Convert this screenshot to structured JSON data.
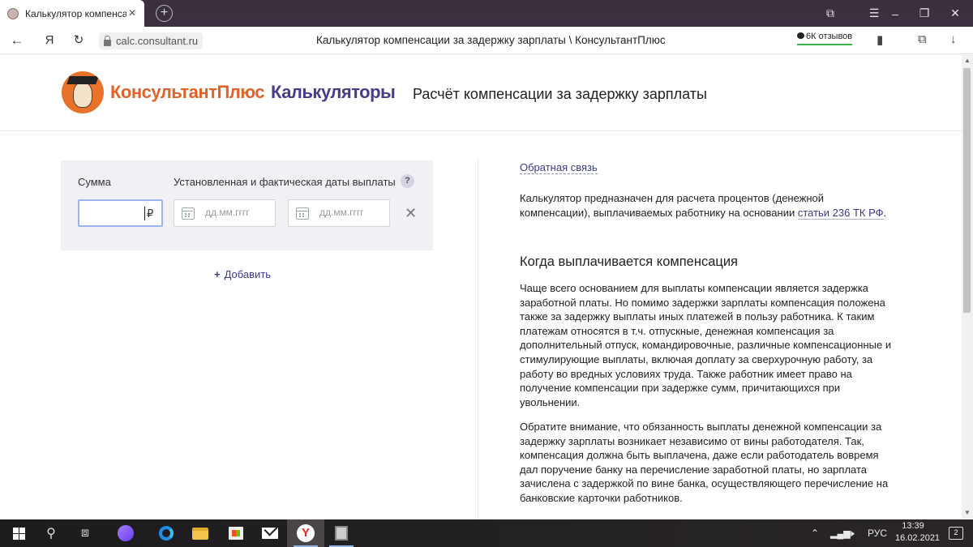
{
  "browser": {
    "tab_title": "Калькулятор компенсаций",
    "tab_close": "✕",
    "new_tab": "+",
    "url": "calc.consultant.ru",
    "page_title": "Калькулятор компенсации за задержку зарплаты \\ КонсультантПлюс",
    "reviews": "6К отзывов",
    "yandex_glyph": "Я"
  },
  "header": {
    "brand": "КонсультантПлюс",
    "brand_sub": "Калькуляторы",
    "title": "Расчёт компенсации за задержку зарплаты"
  },
  "form": {
    "sum_label": "Сумма",
    "dates_label": "Установленная и фактическая даты выплаты",
    "help": "?",
    "sum_value": "",
    "currency": "₽",
    "date_placeholder_1": "дд.мм.гггг",
    "date_placeholder_2": "дд.мм.гггг",
    "clear": "✕",
    "add_plus": "+",
    "add_label": "Добавить"
  },
  "content": {
    "feedback": "Обратная связь",
    "intro_text": "Калькулятор предназначен для расчета процентов (денежной компенсации), выплачиваемых работнику на основании ",
    "intro_link": "статьи 236 ТК РФ",
    "intro_end": ".",
    "section_title": "Когда выплачивается компенсация",
    "para1": "Чаще всего основанием для выплаты компенсации является задержка заработной платы. Но помимо задержки зарплаты компенсация положена также за задержку выплаты иных платежей в пользу работника. К таким платежам относятся в т.ч. отпускные, денежная компенсация за дополнительный отпуск, командировочные, различные компенсационные и стимулирующие выплаты, включая доплату за сверхурочную работу, за работу во вредных условиях труда. Также работник имеет право на получение компенсации при задержке сумм, причитающихся при увольнении.",
    "para2": "Обратите внимание, что обязанность выплаты денежной компенсации за задержку зарплаты возникает независимо от вины работодателя. Так, компенсация должна быть выплачена, даже если работодатель вовремя дал поручение банку на перечисление заработной платы, но зарплата зачислена с задержкой по вине банка, осуществляющего перечисление на банковские карточки работников."
  },
  "taskbar": {
    "language": "РУС",
    "time": "13:39",
    "date": "16.02.2021",
    "notifications": "2"
  }
}
